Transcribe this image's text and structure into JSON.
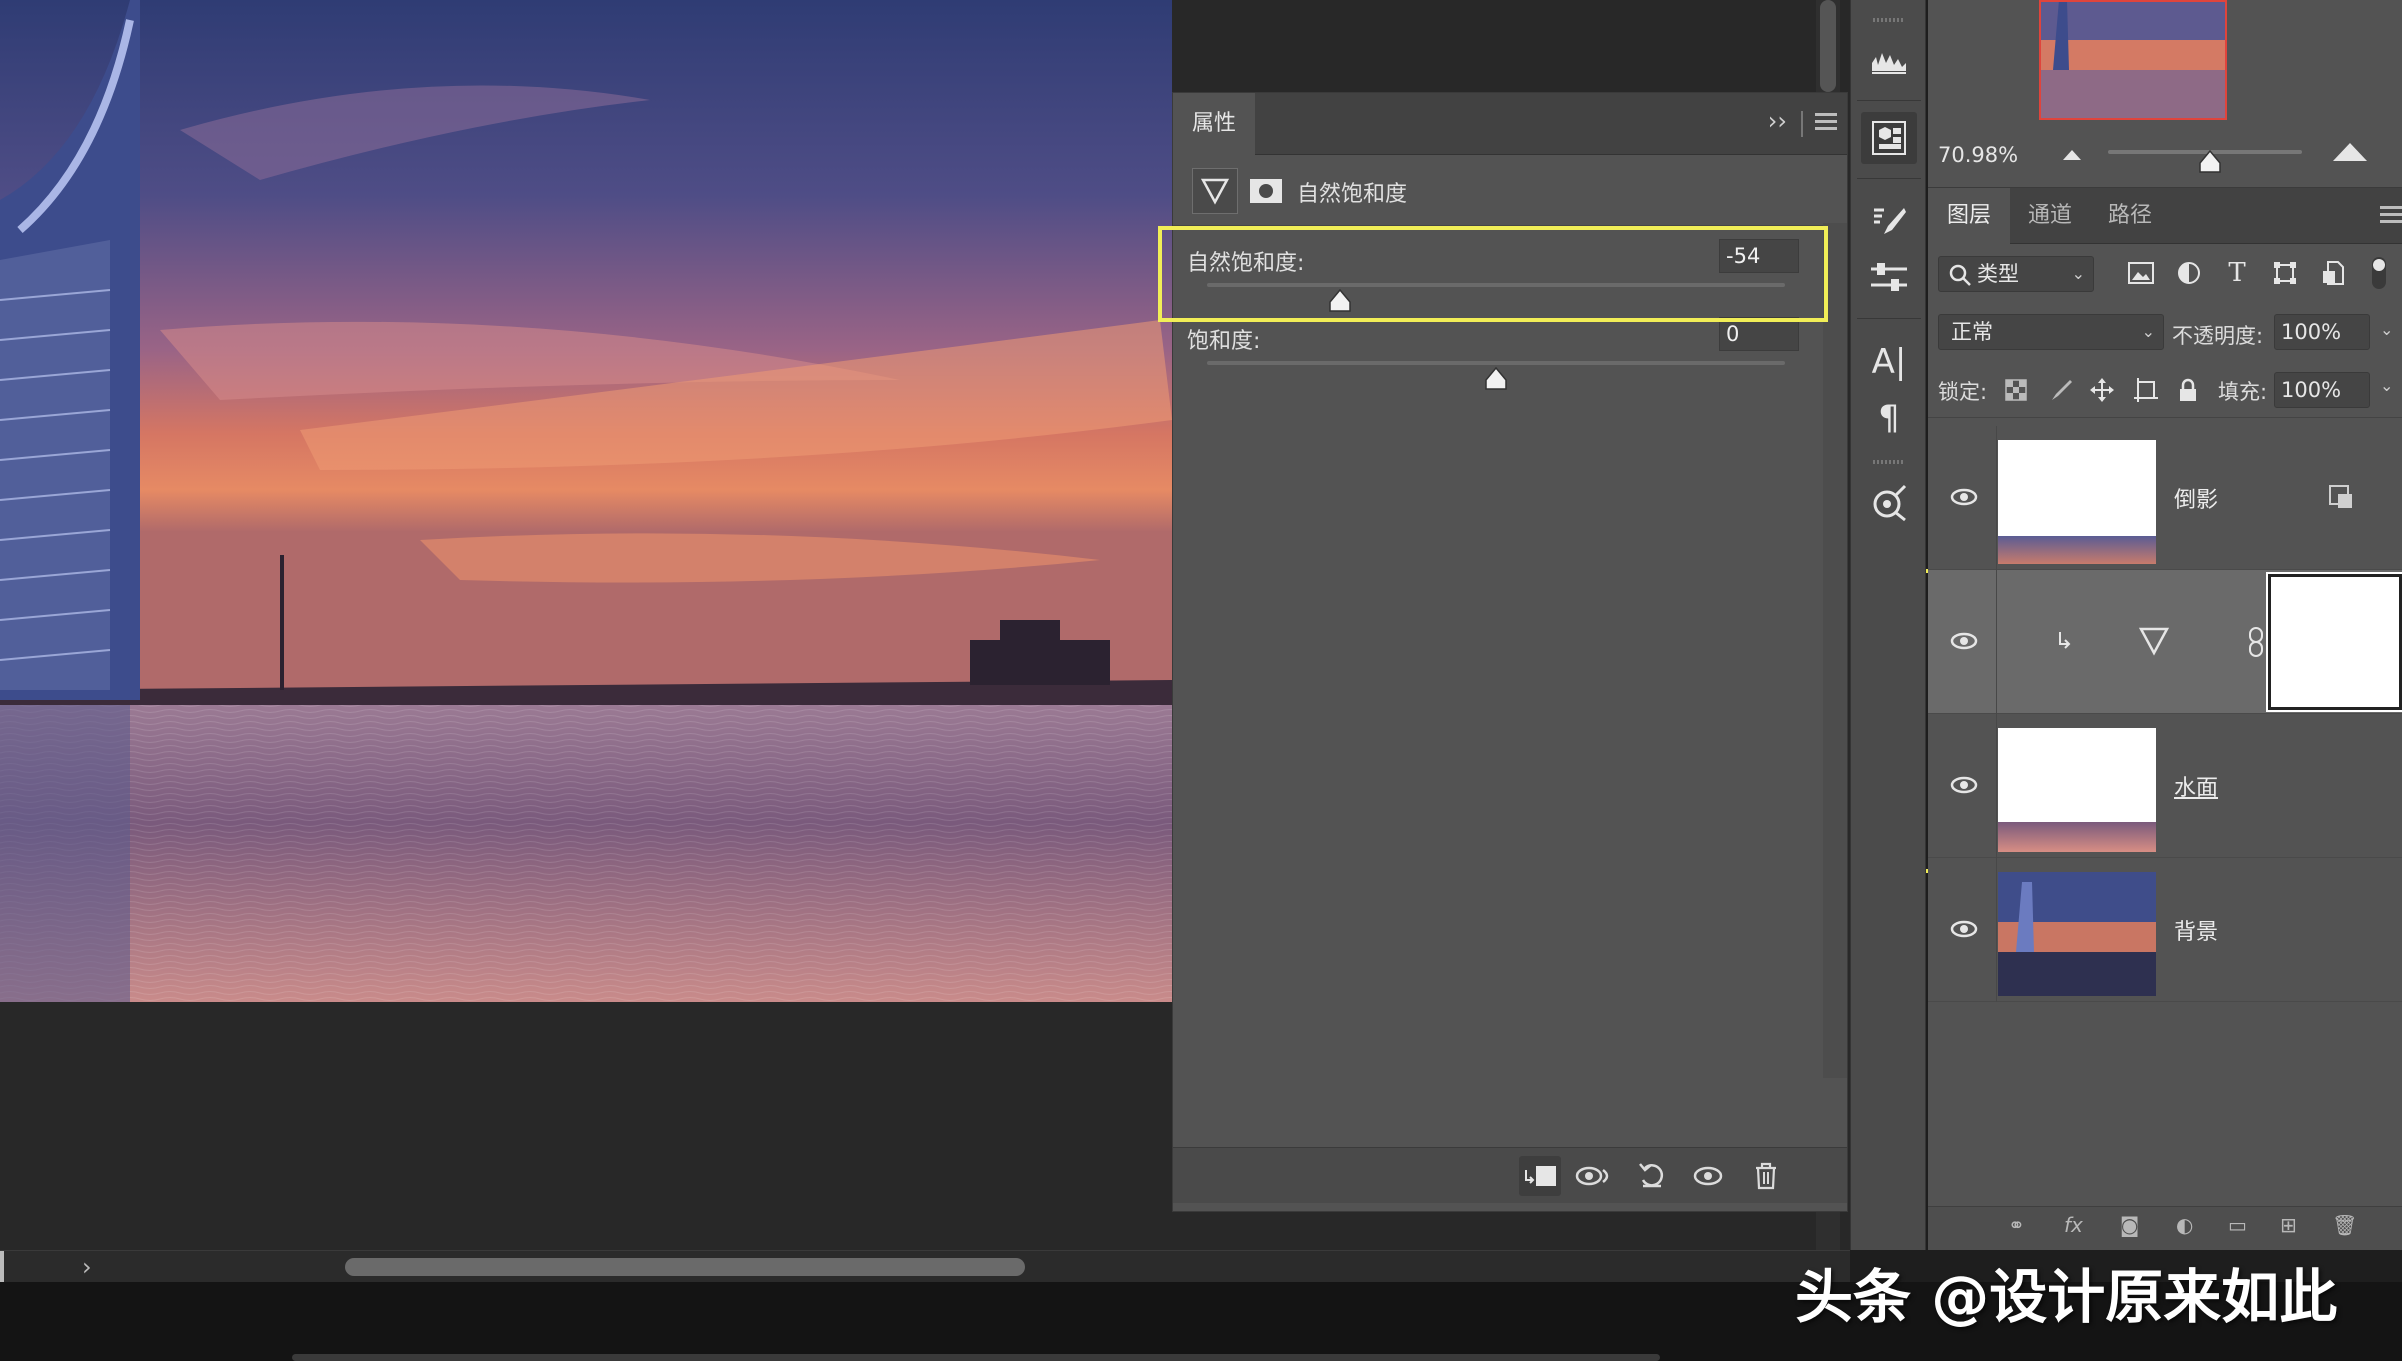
{
  "properties_panel": {
    "tab_label": "属性",
    "adjustment_title": "自然饱和度",
    "sliders": [
      {
        "label": "自然饱和度:",
        "value": "-54",
        "level": -54,
        "min": -100,
        "max": 100
      },
      {
        "label": "饱和度:",
        "value": "0",
        "level": 0,
        "min": -100,
        "max": 100
      }
    ],
    "highlight_color": "#f1ee57"
  },
  "navigator": {
    "zoom": "70.98%"
  },
  "layers_panel": {
    "tabs": [
      "图层",
      "通道",
      "路径"
    ],
    "filter_kind": "类型",
    "blend_mode": "正常",
    "opacity_label": "不透明度:",
    "opacity": "100%",
    "lock_label": "锁定:",
    "fill_label": "填充:",
    "fill": "100%",
    "layers": [
      {
        "name": "倒影",
        "kind": "pixel",
        "visible": true
      },
      {
        "name": "",
        "kind": "vibrance-adjustment",
        "visible": true,
        "selected": true,
        "clipped": true
      },
      {
        "name": "水面",
        "kind": "pixel",
        "visible": true
      },
      {
        "name": "背景",
        "kind": "pixel",
        "visible": true
      }
    ]
  },
  "watermark": "头条 @设计原来如此"
}
